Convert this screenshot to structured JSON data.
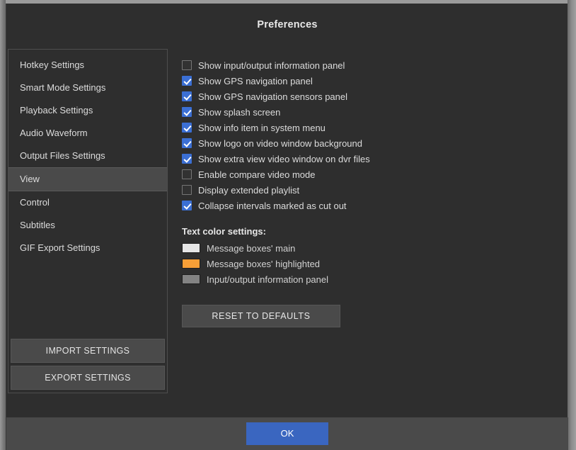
{
  "dialog": {
    "title": "Preferences"
  },
  "sidebar": {
    "items": [
      {
        "label": "Hotkey Settings",
        "selected": false
      },
      {
        "label": "Smart Mode Settings",
        "selected": false
      },
      {
        "label": "Playback Settings",
        "selected": false
      },
      {
        "label": "Audio Waveform",
        "selected": false
      },
      {
        "label": "Output Files Settings",
        "selected": false
      },
      {
        "label": "View",
        "selected": true
      },
      {
        "label": "Control",
        "selected": false
      },
      {
        "label": "Subtitles",
        "selected": false
      },
      {
        "label": "GIF Export Settings",
        "selected": false
      }
    ],
    "import_label": "IMPORT SETTINGS",
    "export_label": "EXPORT SETTINGS"
  },
  "view_settings": {
    "checkboxes": [
      {
        "label": "Show input/output information panel",
        "checked": false
      },
      {
        "label": "Show GPS navigation panel",
        "checked": true
      },
      {
        "label": "Show GPS navigation sensors panel",
        "checked": true
      },
      {
        "label": "Show splash screen",
        "checked": true
      },
      {
        "label": "Show info item in system menu",
        "checked": true
      },
      {
        "label": "Show logo on video window background",
        "checked": true
      },
      {
        "label": "Show extra view video window on dvr files",
        "checked": true
      },
      {
        "label": "Enable compare video mode",
        "checked": false
      },
      {
        "label": "Display extended playlist",
        "checked": false
      },
      {
        "label": "Collapse intervals marked as cut out",
        "checked": true
      }
    ],
    "text_color_heading": "Text color settings:",
    "text_colors": [
      {
        "label": "Message boxes' main",
        "color": "#e6e6e6"
      },
      {
        "label": "Message boxes' highlighted",
        "color": "#f79f37"
      },
      {
        "label": "Input/output information panel",
        "color": "#838383"
      }
    ],
    "reset_label": "RESET TO DEFAULTS"
  },
  "footer": {
    "ok_label": "OK"
  }
}
